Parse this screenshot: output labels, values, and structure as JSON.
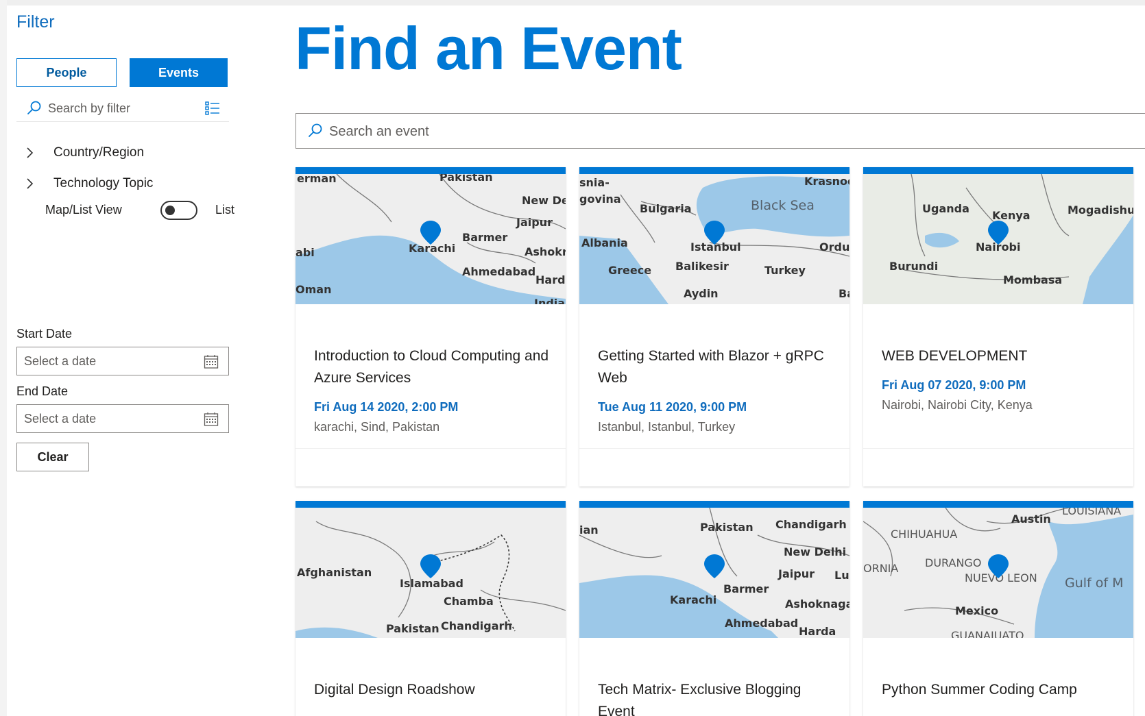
{
  "sidebar": {
    "title": "Filter",
    "people_label": "People",
    "events_label": "Events",
    "search_placeholder": "Search by filter",
    "tree": [
      {
        "label": "Country/Region"
      },
      {
        "label": "Technology Topic"
      }
    ],
    "map_list_label": "Map/List View",
    "list_label": "List",
    "start_date_label": "Start Date",
    "end_date_label": "End Date",
    "date_placeholder": "Select a date",
    "clear_label": "Clear"
  },
  "main": {
    "title": "Find an Event",
    "search_placeholder": "Search an event",
    "events": [
      {
        "title": "Introduction to Cloud Computing and Azure Services",
        "date": "Fri Aug 14 2020, 2:00 PM",
        "location": "karachi, Sind, Pakistan",
        "map_labels": [
          "erman",
          "Pakistan",
          "New De",
          "Jaipur",
          "Barmer",
          "Karachi",
          "Ashokr",
          "abi",
          "Ahmedabad",
          "Hard",
          "Oman",
          "India"
        ]
      },
      {
        "title": "Getting Started with Blazor + gRPC Web",
        "date": "Tue Aug 11 2020, 9:00 PM",
        "location": "Istanbul, Istanbul, Turkey",
        "map_labels": [
          "snia-",
          "govina",
          "Bulgaria",
          "Black Sea",
          "Krasnod",
          "Albania",
          "Istanbul",
          "Ordu",
          "Greece",
          "Balikesir",
          "Turkey",
          "Aydin",
          "Ba"
        ]
      },
      {
        "title": "WEB DEVELOPMENT",
        "date": "Fri Aug 07 2020, 9:00 PM",
        "location": "Nairobi, Nairobi City, Kenya",
        "map_labels": [
          "Uganda",
          "Kenya",
          "Mogadishu",
          "Nairobi",
          "Burundi",
          "Mombasa"
        ]
      },
      {
        "title": "Digital Design Roadshow",
        "date": "",
        "location": "",
        "map_labels": [
          "Afghanistan",
          "Islamabad",
          "Chamba",
          "Pakistan",
          "Chandigarh"
        ]
      },
      {
        "title": "Tech Matrix- Exclusive Blogging Event",
        "date": "",
        "location": "",
        "map_labels": [
          "Pakistan",
          "Chandigarh",
          "ian",
          "New Delhi",
          "Jaipur",
          "Lu",
          "Barmer",
          "Karachi",
          "Ashoknaga",
          "Ahmedabad",
          "Harda"
        ]
      },
      {
        "title": "Python Summer Coding Camp",
        "date": "",
        "location": "",
        "map_labels": [
          "Austin",
          "LOUISIANA",
          "CHIHUAHUA",
          "DURANGO",
          "ORNIA",
          "NUEVO LEON",
          "Gulf of M",
          "Mexico",
          "GUANAJUATO"
        ]
      }
    ]
  },
  "colors": {
    "accent": "#0078d4",
    "link": "#0f6cbd",
    "water": "#9cc8e8",
    "land": "#eeeeee"
  }
}
